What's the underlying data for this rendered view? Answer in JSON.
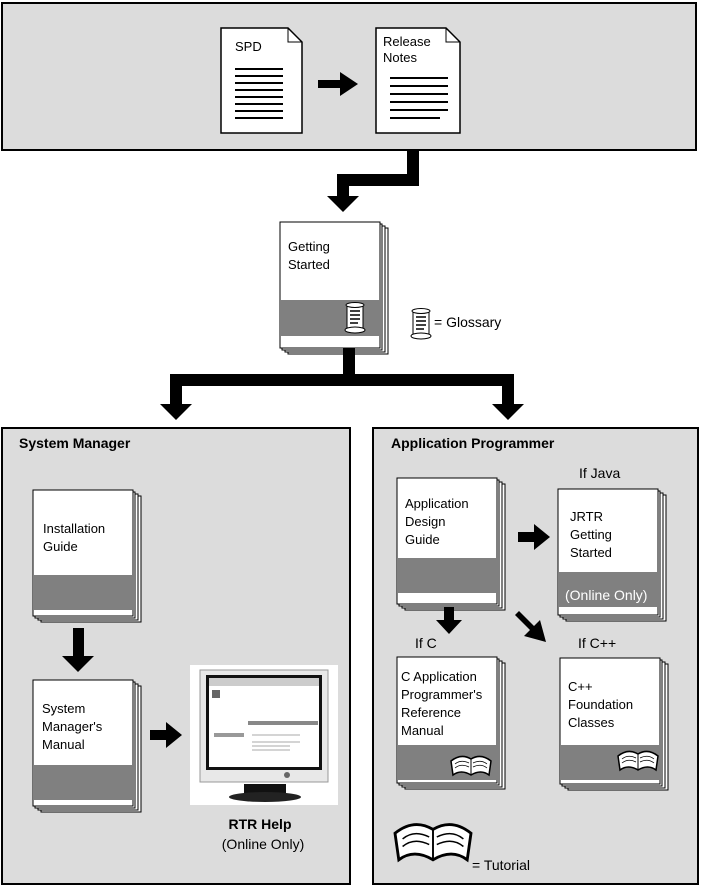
{
  "colors": {
    "panel": "#dcdcdc",
    "band": "#808080",
    "ink": "#000000"
  },
  "top": {
    "spd": "SPD",
    "release_notes": [
      "Release",
      "Notes"
    ]
  },
  "getting_started": [
    "Getting",
    "Started"
  ],
  "legend": {
    "glossary": "= Glossary",
    "tutorial": "= Tutorial"
  },
  "system_manager": {
    "title": "System Manager",
    "installation_guide": [
      "Installation",
      "Guide"
    ],
    "manual": [
      "System",
      "Manager's",
      "Manual"
    ],
    "rtr_help": "RTR Help",
    "rtr_help_note": "(Online Only)"
  },
  "application_programmer": {
    "title": "Application Programmer",
    "design_guide": [
      "Application",
      "Design",
      "Guide"
    ],
    "if_java": "If Java",
    "jrtr": [
      "JRTR",
      "Getting",
      "Started"
    ],
    "jrtr_note": "(Online Only)",
    "if_c": "If C",
    "c_ref": [
      "C Application",
      "Programmer's",
      "Reference",
      "Manual"
    ],
    "if_cpp": "If C++",
    "cpp": [
      "C++",
      "Foundation",
      "Classes"
    ]
  }
}
